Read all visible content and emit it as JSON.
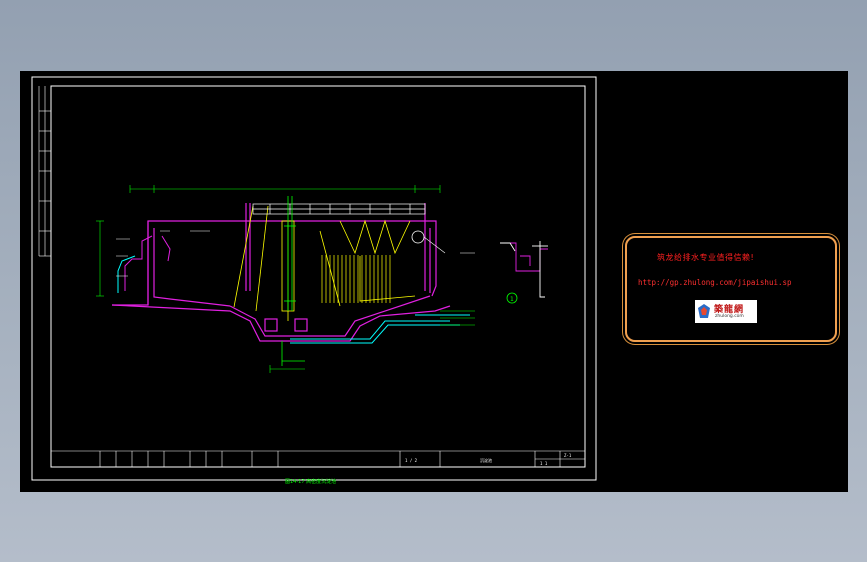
{
  "drawing": {
    "caption": "图14-17  高密度沉淀池",
    "detail_marker": "1",
    "title_block": {
      "drawing_name": "沉淀池",
      "sheet_fraction": "1 / 2",
      "field_a": "Z-1",
      "field_b": "1  1"
    }
  },
  "watermark": {
    "title": "筑龙给排水专业值得信赖!",
    "url": "http://gp.zhulong.com/jipaishui.sp",
    "logo_text": "築龍網",
    "logo_domain": "zhulong.com"
  },
  "colors": {
    "background": "#000000",
    "frame": "#ffffff",
    "structure": "#e020e0",
    "tank": "#ffff00",
    "dimension": "#00ff00",
    "pipe": "#00ffff",
    "watermark_border": "#f0a050",
    "watermark_text": "#ff2020"
  }
}
